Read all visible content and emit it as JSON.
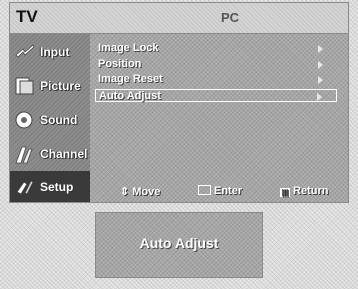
{
  "header": {
    "logo": "TV",
    "title": "PC"
  },
  "sidebar": {
    "items": [
      {
        "label": "Input",
        "icon": "input-icon"
      },
      {
        "label": "Picture",
        "icon": "picture-icon"
      },
      {
        "label": "Sound",
        "icon": "sound-icon"
      },
      {
        "label": "Channel",
        "icon": "channel-icon"
      },
      {
        "label": "Setup",
        "icon": "setup-icon",
        "active": true
      }
    ]
  },
  "menu": {
    "options": [
      {
        "label": "Image Lock"
      },
      {
        "label": "Position"
      },
      {
        "label": "Image Reset"
      },
      {
        "label": "Auto Adjust",
        "selected": true
      }
    ]
  },
  "footer": {
    "move": "Move",
    "enter": "Enter",
    "return": "Return"
  },
  "popup": {
    "text": "Auto Adjust"
  }
}
